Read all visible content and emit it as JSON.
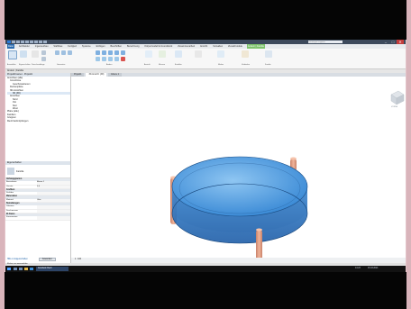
{
  "titlebar": {
    "search_placeholder": "Suchbegriff eingeben",
    "minimize": "–",
    "maximize": "□",
    "close": "✕"
  },
  "ribbon": {
    "tabs": [
      "Datei",
      "Architektur",
      "Ingenieurbau",
      "Stahlbau",
      "Fertigteil",
      "Systeme",
      "Einfügen",
      "Beschriften",
      "Berechnung",
      "Körpermodell & Grundstück",
      "Zusammenarbeit",
      "Ansicht",
      "Verwalten",
      "Zusatzmodule",
      "Ändern | Familie"
    ],
    "groups": [
      "Auswählen",
      "Eigenschaften",
      "Zwischenablage",
      "Geometrie",
      "Ändern",
      "Ansicht",
      "Messen",
      "Erstellen",
      "Modus",
      "Verbinden",
      "Familie"
    ]
  },
  "optionsbar": {
    "label": "Ändern | Familie"
  },
  "project_browser": {
    "title": "Projektbrowser - Projekt1",
    "items": [
      "Ansichten (alle)",
      "Grundrisse",
      "Geschossebenen",
      "Deckenpläne",
      "3D-Ansichten",
      "3D {3D}",
      "Ansichten",
      "Nord",
      "Ost",
      "Süd",
      "West",
      "Pläne (alle)",
      "Familien",
      "Gruppen",
      "Revit-Verknüpfungen"
    ]
  },
  "properties": {
    "title": "Eigenschaften",
    "type": "Familie",
    "sections": [
      {
        "header": "Abhängigkeiten",
        "rows": [
          [
            "Basisebene",
            "Ebene 1"
          ],
          [
            "Versatz",
            "0.0"
          ]
        ]
      },
      {
        "header": "Grafiken",
        "rows": [
          [
            "Sichtbar",
            ""
          ]
        ]
      },
      {
        "header": "Materialien",
        "rows": [
          [
            "Material",
            "Glas"
          ]
        ]
      },
      {
        "header": "Bemaßungen",
        "rows": [
          [
            "Volumen",
            ""
          ],
          [
            "Durchmesser",
            ""
          ]
        ]
      },
      {
        "header": "ID-Daten",
        "rows": [
          [
            "Kommentare",
            ""
          ]
        ]
      }
    ],
    "apply": "Anwenden",
    "help_link": "Hilfe zu Eigenschaften"
  },
  "view_tabs": [
    "Projekt1",
    "3D-Ansicht: {3D}",
    "Ebene 1"
  ],
  "viewcube_label": "VORNE",
  "view_control": {
    "scale": "1 : 100"
  },
  "statusbar": {
    "text": "Klicken, um auszuwählen"
  },
  "taskbar": {
    "active_app": "Autodesk Revit",
    "time": "14:23",
    "date": "15.03.2021"
  }
}
